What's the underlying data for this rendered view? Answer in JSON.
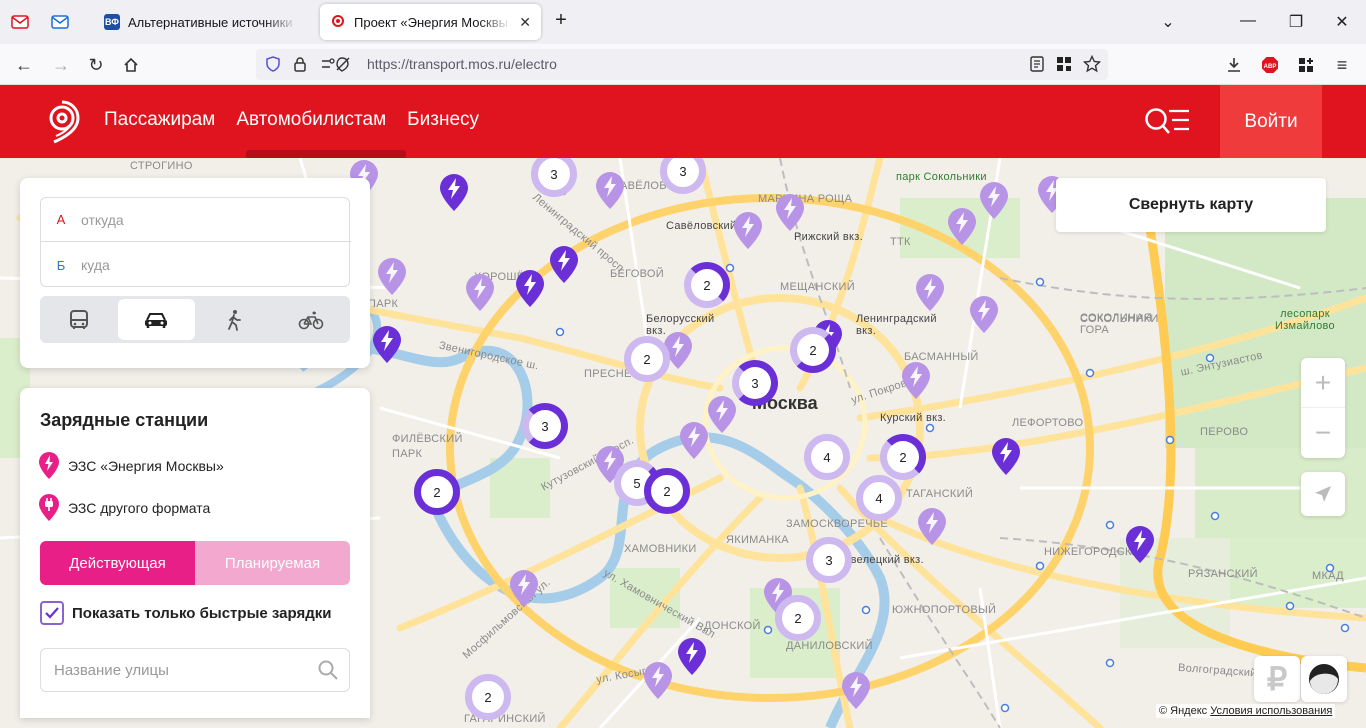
{
  "browser": {
    "tabs": [
      {
        "title": "Альтернативные источники эн",
        "active": false
      },
      {
        "title": "Проект «Энергия Москвы» - Е",
        "active": true
      }
    ],
    "new_tab_label": "+",
    "url": "https://transport.mos.ru/electro"
  },
  "header": {
    "nav": [
      "Пассажирам",
      "Автомобилистам",
      "Бизнесу"
    ],
    "login_label": "Войти"
  },
  "route": {
    "from_letter": "А",
    "from_placeholder": "откуда",
    "to_letter": "Б",
    "to_placeholder": "куда",
    "modes": [
      "bus",
      "car",
      "walk",
      "bike"
    ],
    "active_mode": "car"
  },
  "legend": {
    "title": "Зарядные станции",
    "own_label": "ЭЗС «Энергия Москвы»",
    "other_label": "ЭЗС другого формата",
    "status_active": "Действующая",
    "status_planned": "Планируемая",
    "fast_only_label": "Показать только быстрые зарядки",
    "fast_only_checked": true,
    "street_placeholder": "Название улицы"
  },
  "map": {
    "collapse_label": "Свернуть карту",
    "zoom_in": "+",
    "zoom_out": "−",
    "ruble": "₽",
    "copyright": "© Яндекс",
    "terms": "Условия использования",
    "labels": [
      {
        "t": "СТРОГИНО"
      },
      {
        "t": "ХОРОШЁВО"
      },
      {
        "t": "ПАРК"
      },
      {
        "t": "ФИЛЁВСКИЙ"
      },
      {
        "t": "ПАРК"
      },
      {
        "t": "ПРЕСНЕ"
      },
      {
        "t": "ХАМОВНИКИ"
      },
      {
        "t": "БЕГОВОЙ"
      },
      {
        "t": "САВЁЛОВСКИЙ"
      },
      {
        "t": "МАРЬИНА РОЩА"
      },
      {
        "t": "Савёловский вкз."
      },
      {
        "t": "Белорусский вкз."
      },
      {
        "t": "Рижский вкз."
      },
      {
        "t": "МЕЩАНСКИЙ"
      },
      {
        "t": "Ленинградский вкз."
      },
      {
        "t": "БАСМАННЫЙ"
      },
      {
        "t": "Курский вкз."
      },
      {
        "t": "Москва"
      },
      {
        "t": "ЗАМОСКВОРЕЧЬЕ"
      },
      {
        "t": "ЯКИМАНКА"
      },
      {
        "t": "Павелецкий вкз."
      },
      {
        "t": "ДОНСКОЙ"
      },
      {
        "t": "ДАНИЛОВСКИЙ"
      },
      {
        "t": "ЮЖНОПОРТОВЫЙ"
      },
      {
        "t": "ТАГАНСКИЙ"
      },
      {
        "t": "ЛЕФОРТОВО"
      },
      {
        "t": "НИЖЕГОРОДСКИЙ"
      },
      {
        "t": "РЯЗАНСКИЙ"
      },
      {
        "t": "ПЕРОВО"
      },
      {
        "t": "СОКОЛЬНИКИ"
      },
      {
        "t": "СОКОЛИНАЯ ГОРА"
      },
      {
        "t": "парк Сокольники"
      },
      {
        "t": "лесопарк Измайлово"
      },
      {
        "t": "ГАГАРИНСКИЙ"
      },
      {
        "t": "ТТК"
      },
      {
        "t": "МКАД"
      },
      {
        "t": "Звенигородское ш."
      },
      {
        "t": "Кутузовский просп."
      },
      {
        "t": "ул. Косыгина"
      },
      {
        "t": "ш. Энтузиастов"
      },
      {
        "t": "Волгоградский просп."
      },
      {
        "t": "ул. Покровка"
      },
      {
        "t": "Ленинградский просп."
      },
      {
        "t": "Мосфильмовская ул."
      },
      {
        "t": "ул. Хамовнический Вал"
      }
    ],
    "clusters": [
      {
        "n": "3"
      },
      {
        "n": "3"
      },
      {
        "n": "2"
      },
      {
        "n": "2"
      },
      {
        "n": "2"
      },
      {
        "n": "3"
      },
      {
        "n": "3"
      },
      {
        "n": "2"
      },
      {
        "n": "5"
      },
      {
        "n": "2"
      },
      {
        "n": "4"
      },
      {
        "n": "2"
      },
      {
        "n": "4"
      },
      {
        "n": "3"
      },
      {
        "n": "2"
      },
      {
        "n": "2"
      }
    ]
  }
}
